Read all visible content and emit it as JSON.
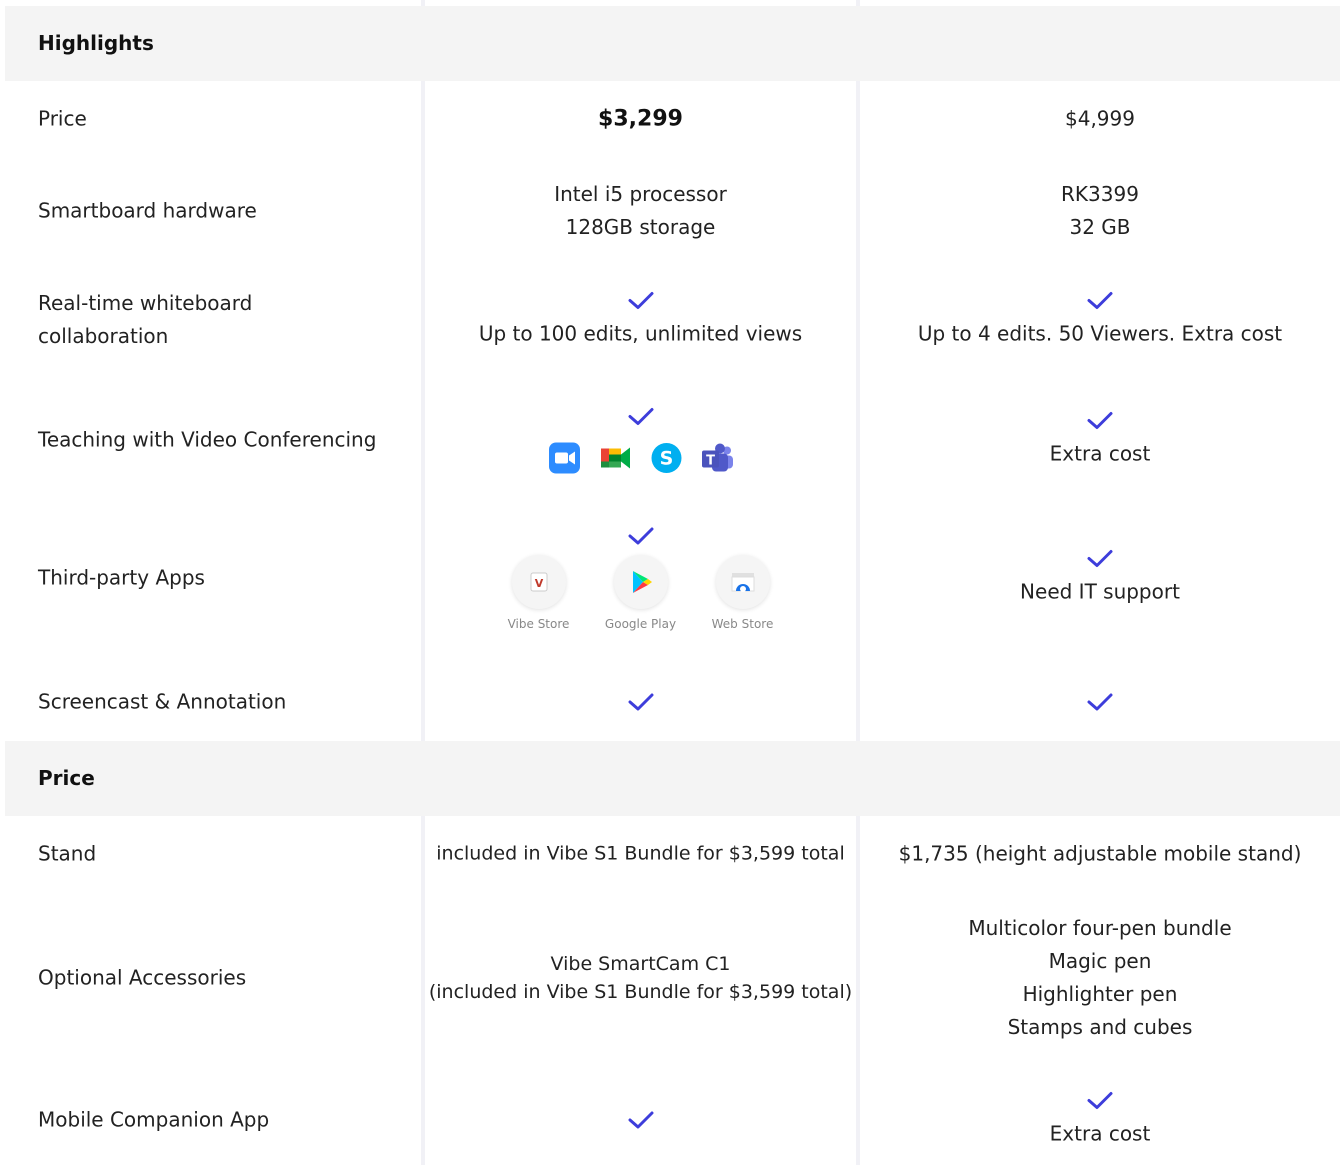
{
  "sections": {
    "highlights": "Highlights",
    "price": "Price"
  },
  "rows": {
    "price": {
      "label": "Price",
      "col1": "$3,299",
      "col2": "$4,999"
    },
    "hardware": {
      "label": "Smartboard hardware",
      "col1": [
        "Intel i5 processor",
        "128GB storage"
      ],
      "col2": [
        "RK3399",
        "32 GB"
      ]
    },
    "whiteboard": {
      "label": [
        "Real-time whiteboard",
        "collaboration"
      ],
      "col1": "Up to 100 edits, unlimited views",
      "col2": "Up to 4 edits. 50 Viewers. Extra cost"
    },
    "video": {
      "label": "Teaching with Video Conferencing",
      "col1_icons": [
        "zoom-icon",
        "google-meet-icon",
        "skype-icon",
        "teams-icon"
      ],
      "col2": "Extra cost"
    },
    "apps": {
      "label": "Third-party Apps",
      "col1_apps": [
        "Vibe Store",
        "Google Play",
        "Web Store"
      ],
      "col2": "Need IT support"
    },
    "screencast": {
      "label": "Screencast & Annotation"
    },
    "stand": {
      "label": "Stand",
      "col1": "included in Vibe S1 Bundle for $3,599 total",
      "col2": "$1,735 (height adjustable mobile stand)"
    },
    "accessories": {
      "label": "Optional Accessories",
      "col1": [
        "Vibe SmartCam C1",
        "(included in Vibe S1 Bundle for $3,599 total)"
      ],
      "col2": [
        "Multicolor four-pen bundle",
        "Magic pen",
        "Highlighter pen",
        "Stamps and cubes"
      ]
    },
    "mobile": {
      "label": "Mobile Companion App",
      "col2": "Extra cost"
    }
  },
  "colors": {
    "check": "#3d3ddb",
    "section_bg": "#f4f4f4",
    "divider": "#f1f1f6"
  }
}
